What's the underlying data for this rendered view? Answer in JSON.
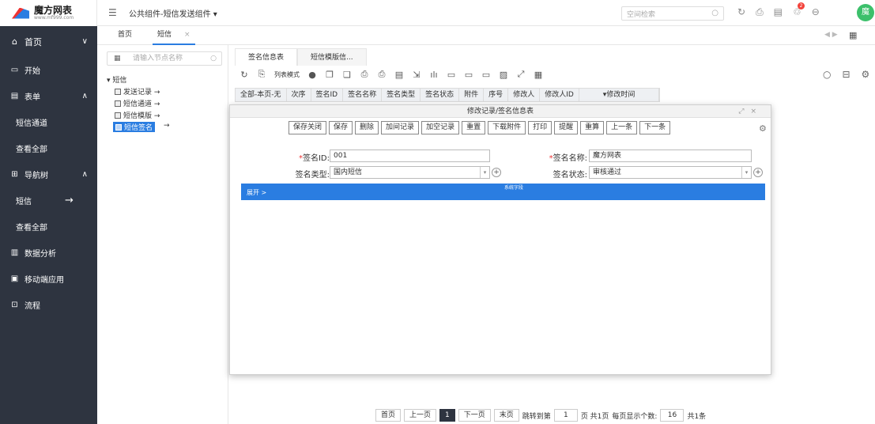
{
  "app": {
    "logo_title": "魔方网表",
    "logo_url": "www.mf999.com",
    "breadcrumb": "公共组件-短信发送组件 ▾",
    "search_placeholder": "空间检索",
    "avatar_initial": "魔",
    "notification_count": "2"
  },
  "nav": {
    "items": [
      {
        "label": "首页",
        "icon": "home-icon",
        "chevron": "∨"
      },
      {
        "label": "开始",
        "icon": "start-icon"
      },
      {
        "label": "表单",
        "icon": "form-icon",
        "chevron": "∧"
      },
      {
        "label": "短信通道"
      },
      {
        "label": "查看全部"
      },
      {
        "label": "导航树",
        "icon": "tree-icon",
        "chevron": "∧"
      },
      {
        "label": "短信",
        "arrow": "→"
      },
      {
        "label": "查看全部"
      },
      {
        "label": "数据分析",
        "icon": "chart-icon"
      },
      {
        "label": "移动端应用",
        "icon": "mobile-icon"
      },
      {
        "label": "流程",
        "icon": "flow-icon"
      }
    ]
  },
  "tabs": {
    "home": "首页",
    "sms": "短信",
    "close": "×"
  },
  "tree": {
    "search_placeholder": "请输入节点名称",
    "root": "▾ 短信",
    "nodes": [
      "发送记录 →",
      "短信通道 →",
      "短信模版 →",
      "短信签名"
    ],
    "selected_arrow": "→"
  },
  "main": {
    "subtabs": [
      "签名信息表",
      "短信模版信..."
    ],
    "list_mode": "列表模式",
    "columns": [
      "全部-本页-无",
      "次序",
      "签名ID",
      "签名名称",
      "签名类型",
      "签名状态",
      "附件",
      "序号",
      "修改人",
      "修改人ID",
      "▾修改时间"
    ],
    "pager": {
      "first": "首页",
      "prev": "上一页",
      "current": "1",
      "next": "下一页",
      "last": "末页",
      "jump_label": "跳转到第",
      "jump_value": "1",
      "pages_info": "页 共1页",
      "page_size_label": "每页显示个数:",
      "page_size": "16",
      "total": "共1条"
    }
  },
  "modal": {
    "title": "修改记录/签名信息表",
    "buttons": [
      "保存关闭",
      "保存",
      "删除",
      "加间记录",
      "加空记录",
      "重置",
      "下载附件",
      "打印",
      "提醒",
      "重算",
      "上一条",
      "下一条"
    ],
    "fields": {
      "sign_id_label": "签名ID:",
      "sign_id_value": "001",
      "sign_name_label": "签名名称:",
      "sign_name_value": "魔方网表",
      "sign_type_label": "签名类型:",
      "sign_type_value": "国内短信",
      "sign_status_label": "签名状态:",
      "sign_status_value": "审核通过",
      "required_mark": "*"
    },
    "expand_label": "展开 >",
    "system_fields_label": "系统字段"
  },
  "colors": {
    "nav_bg": "#2e3440",
    "accent": "#2a7de1",
    "avatar": "#3cc06b",
    "badge": "#f3423a"
  }
}
